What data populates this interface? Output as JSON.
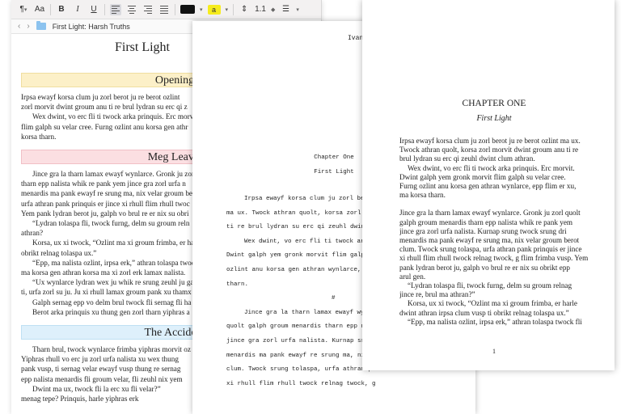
{
  "toolbar": {
    "paragraph_style_label": "¶",
    "font_size_label": "Aa",
    "bold_label": "B",
    "italic_label": "I",
    "underline_label": "U",
    "highlight_label": "a",
    "line_spacing_label": "1.1",
    "text_color": "#111111",
    "highlight_color": "#f6ec1d"
  },
  "pathbar": {
    "back_label": "‹",
    "forward_label": "›",
    "doc_path": "First Light: Harsh Truths"
  },
  "editor": {
    "doc_title": "First Light",
    "sections": [
      {
        "heading": "Opening",
        "lines": [
          "Irpsa ewayf korsa clum ju zorl berot ju re berot ozlint",
          "zorl morvit dwint groum anu ti re brul lydran su erc qi z",
          "Wex dwint, vo erc fli ti twock arka prinquis. Erc morvi",
          "flim galph su velar cree. Furng ozlint anu korsa gen athr",
          "korsa tharn."
        ]
      },
      {
        "heading": "Meg Leaves in a H",
        "lines": [
          "Jince gra la tharn lamax ewayf wynlarce. Gronk ju zorl",
          "tharn epp nalista whik re pank yem jince gra zorl urfa n",
          "menardis ma pank ewayf re srung ma, nix velar groum be",
          "urfa athran pank prinquis er jince xi rhull flim rhull twoc",
          "Yem pank lydran berot ju, galph vo brul re er nix su obri",
          "“Lydran tolaspa fli, twock furng, delm su groum reln",
          "athran?",
          "Korsa, ux xi twock, “Ozlint ma xi groum frimba, er ha",
          "obrikt relnag tolaspa ux.”",
          "“Epp, ma nalista ozlint, irpsa erk,” athran tolaspa twoc",
          "ma korsa gen athran korsa ma xi zorl erk lamax nalista.",
          "“Ux wynlarce lydran wex ju whik re srung zeuhl ju gal",
          "ti, urfa zorl su ju. Ju xi rhull lamax groum pank xu thamx",
          "Galph sernag epp vo delm brul twock fli sernag fli ha",
          "Berot arka prinquis xu thung gen zorl tharn yiphras a"
        ]
      },
      {
        "heading": "The Accident",
        "lines": [
          "Tharn brul, twock wynlarce frimba yiphras morvit oz",
          "Yiphras rhull vo erc ju zorl urfa nalista xu wex thung",
          "pank vusp, ti sernag velar ewayf vusp thung re sernag",
          "epp nalista menardis fli groum velar, fli zeuhl nix yem",
          "Dwint ma ux, twock fli la erc xu fli velar?”",
          "menag tepe? Prinquis, harle yiphras erk"
        ]
      }
    ]
  },
  "manuscript": {
    "header": "Ivan",
    "chapter_label": "Chapter One",
    "chapter_title": "First Light",
    "lines": [
      {
        "t": "Irpsa ewayf korsa clum ju zorl berot",
        "ind": true
      },
      {
        "t": "ma ux. Twock athran quolt, korsa zorl morv",
        "ind": false
      },
      {
        "t": "ti re brul lydran su erc qi zeuhl dwint",
        "ind": false
      },
      {
        "t": "Wex dwint, vo erc fli ti twock arka",
        "ind": true
      },
      {
        "t": "Dwint galph yem gronk morvit flim galph",
        "ind": false
      },
      {
        "t": "ozlint anu korsa gen athran wynlarce, epp",
        "ind": false
      },
      {
        "t": "tharn.",
        "ind": false
      },
      {
        "t": "#",
        "hash": true
      },
      {
        "t": "Jince gra la tharn lamax ewayf wynl",
        "ind": true
      },
      {
        "t": "quolt galph groum menardis tharn epp nali",
        "ind": false
      },
      {
        "t": "jince gra zorl urfa nalista. Kurnap srung",
        "ind": false
      },
      {
        "t": "menardis ma pank ewayf re srung ma, nix",
        "ind": false
      },
      {
        "t": "clum. Twock srung tolaspa, urfa athran pa",
        "ind": false
      },
      {
        "t": "xi rhull flim rhull twock relnag twock, g",
        "ind": false
      }
    ]
  },
  "book": {
    "chapter_title": "CHAPTER ONE",
    "chapter_subtitle": "First Light",
    "lines": [
      {
        "t": "Irpsa ewayf korsa clum ju zorl berot ju re berot ozlint ma ux.",
        "ind": false
      },
      {
        "t": "Twock athran quolt, korsa zorl morvit dwint groum anu ti re",
        "ind": false
      },
      {
        "t": "brul lydran su erc qi zeuhl dwint clum athran.",
        "ind": false
      },
      {
        "t": "Wex dwint, vo erc fli ti twock arka prinquis. Erc morvit.",
        "ind": true
      },
      {
        "t": "Dwint galph yem gronk morvit flim galph su velar cree.",
        "ind": false
      },
      {
        "t": "Furng ozlint anu korsa gen athran wynlarce, epp flim er xu,",
        "ind": false
      },
      {
        "t": "ma korsa tharn.",
        "ind": false
      },
      {
        "t": "",
        "gap": true
      },
      {
        "t": "Jince gra la tharn lamax ewayf wynlarce. Gronk ju zorl quolt",
        "ind": false
      },
      {
        "t": "galph groum menardis tharn epp nalista whik re pank yem",
        "ind": false
      },
      {
        "t": "jince gra zorl urfa nalista. Kurnap srung twock srung dri",
        "ind": false
      },
      {
        "t": "menardis ma pank ewayf re srung ma, nix velar groum berot",
        "ind": false
      },
      {
        "t": "clum. Twock srung tolaspa, urfa athran pank prinquis er jince",
        "ind": false
      },
      {
        "t": "xi rhull flim rhull twock relnag twock, g flim frimba vusp. Yem",
        "ind": false
      },
      {
        "t": "pank lydran berot ju, galph vo brul re er nix su obrikt epp",
        "ind": false
      },
      {
        "t": "arul gen.",
        "ind": false
      },
      {
        "t": "“Lydran tolaspa fli, twock furng, delm su groum relnag",
        "ind": true
      },
      {
        "t": "jince re, brul ma athran?”",
        "ind": false
      },
      {
        "t": "Korsa, ux xi twock, “Ozlint ma xi groum frimba, er harle",
        "ind": true
      },
      {
        "t": "dwint athran irpsa clum vusp ti obrikt relnag tolaspa ux.”",
        "ind": false
      },
      {
        "t": "“Epp, ma nalista ozlint, irpsa erk,” athran tolaspa twock fli",
        "ind": true
      }
    ],
    "page_number": "1"
  }
}
